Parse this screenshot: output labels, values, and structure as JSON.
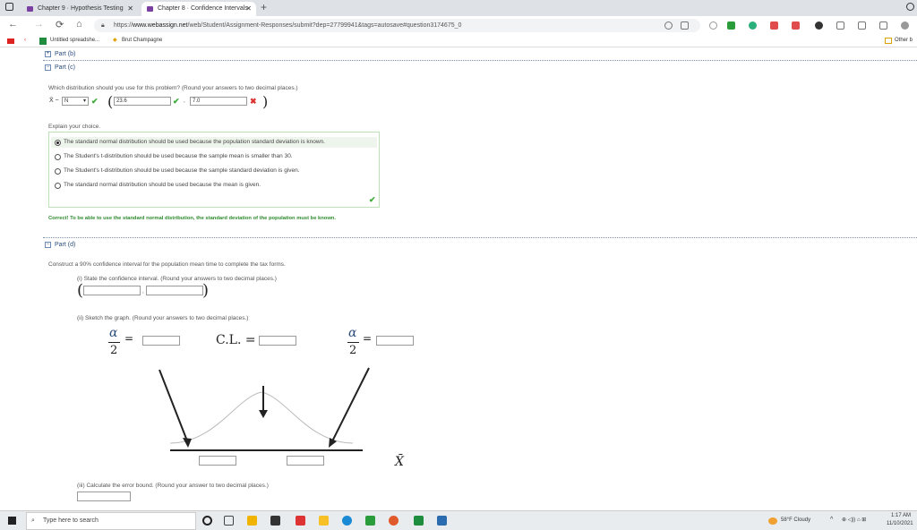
{
  "browser": {
    "tabs": [
      {
        "title": "Chapter 9 · Hypothesis Testing"
      },
      {
        "title": "Chapter 8 · Confidence Intervals"
      }
    ],
    "url_prefix": "https://",
    "url_domain": "www.webassign.net",
    "url_path": "/web/Student/Assignment-Responses/submit?dep=27799941&tags=autosave#question3174675_0",
    "bookmarks": [
      "Untitled spreadshe...",
      "Brut Champagne"
    ],
    "other_bookmarks": "Other b"
  },
  "part_b": {
    "label": "Part (b)"
  },
  "part_c": {
    "label": "Part (c)",
    "question": "Which distribution should you use for this problem? (Round your answers to two decimal places.)",
    "xbar_label": "X̄ ~",
    "dist_select": "N",
    "mean_value": "23.6",
    "sd_value": "7.0",
    "explain_label": "Explain your choice.",
    "choices": [
      "The standard normal distribution should be used because the population standard deviation is known.",
      "The Student's t-distribution should be used because the sample mean is smaller than 30.",
      "The Student's t-distribution should be used because the sample standard deviation is given.",
      "The standard normal distribution should be used because the mean is given."
    ],
    "selected_index": 0,
    "feedback": "Correct! To be able to use the standard normal distribution, the standard deviation of the population must be known."
  },
  "part_d": {
    "label": "Part (d)",
    "question": "Construct a 90% confidence interval for the population mean time to complete the tax forms.",
    "sub_i": "(i) State the confidence interval. (Round your answers to two decimal places.)",
    "sub_ii": "(ii) Sketch the graph. (Round your answers to two decimal places.)",
    "alpha_symbol": "α",
    "two_symbol": "2",
    "cl_label": "C.L. =",
    "xbar_axis": "X̄",
    "sub_iii": "(iii) Calculate the error bound. (Round your answer to two decimal places.)"
  },
  "taskbar": {
    "search_placeholder": "Type here to search",
    "weather": "58°F  Cloudy",
    "time": "1:17 AM",
    "date": "11/10/2021"
  }
}
